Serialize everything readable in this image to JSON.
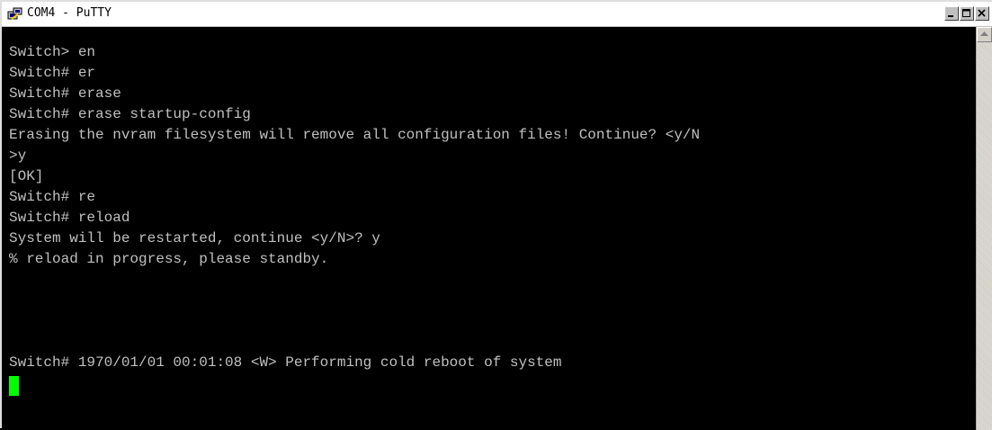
{
  "window": {
    "title": "COM4 - PuTTY",
    "icons": {
      "app": "putty-icon",
      "minimize": "minimize-icon",
      "maximize": "maximize-icon",
      "close": "close-icon"
    }
  },
  "terminal": {
    "lines": [
      "Switch> en",
      "Switch# er",
      "Switch# erase",
      "Switch# erase startup-config",
      "Erasing the nvram filesystem will remove all configuration files! Continue? <y/N",
      ">y",
      "[OK]",
      "Switch# re",
      "Switch# reload",
      "System will be restarted, continue <y/N>? y",
      "% reload in progress, please standby.",
      "",
      "Switch# 1970/01/01 00:01:08 <W> Performing cold reboot of system"
    ],
    "colors": {
      "background": "#000000",
      "text": "#c0c0c0",
      "cursor": "#00ff00"
    }
  }
}
